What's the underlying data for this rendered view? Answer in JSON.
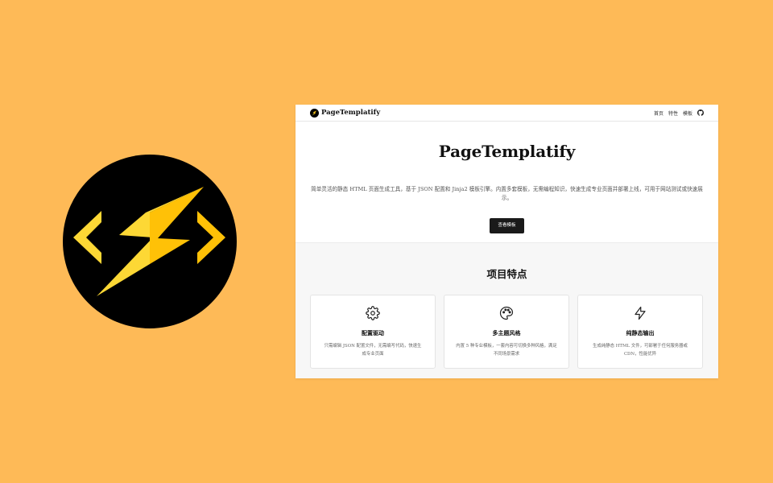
{
  "colors": {
    "background": "#FEBA57",
    "logo_circle": "#000000",
    "bolt_light": "#FDD835",
    "bolt_dark": "#FFC107",
    "button": "#1a1a1a"
  },
  "app": {
    "brand_name": "PageTemplatify",
    "brand_icon": "lightning-logo-icon"
  },
  "nav": {
    "links": [
      "首页",
      "特性",
      "模板"
    ],
    "github_icon": "github-icon"
  },
  "hero": {
    "title": "PageTemplatify",
    "description": "简单灵活的静态 HTML 页面生成工具，基于 JSON 配置和 Jinja2 模板引擎。内置多套模板，无需编程知识，快速生成专业页面并部署上线，可用于网站测试或快速展示。",
    "button_label": "查看模板"
  },
  "features": {
    "title": "项目特点",
    "items": [
      {
        "icon": "gear-icon",
        "title": "配置驱动",
        "description": "只需编辑 JSON 配置文件，无需编写代码，快速生成专业页面"
      },
      {
        "icon": "palette-icon",
        "title": "多主题风格",
        "description": "内置 5 种专业模板，一套内容可切换多种风格，满足不同场景需求"
      },
      {
        "icon": "lightning-icon",
        "title": "纯静态输出",
        "description": "生成纯静态 HTML 文件，可部署于任何服务器或 CDN，性能优异"
      }
    ]
  }
}
